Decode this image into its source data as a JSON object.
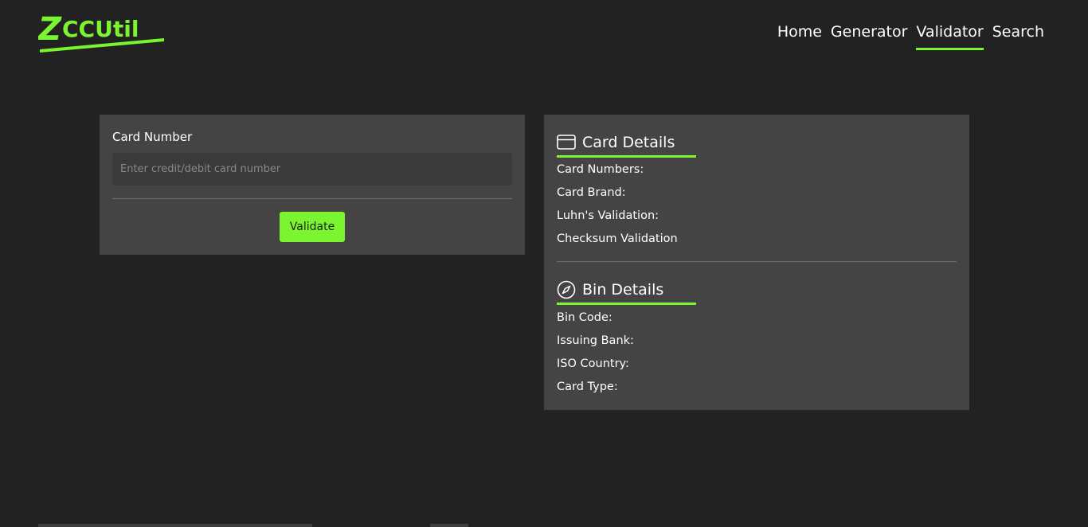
{
  "brand": {
    "logo_text": "ZCCUtil",
    "accent_color": "#7af530"
  },
  "nav": {
    "items": [
      {
        "label": "Home",
        "active": false
      },
      {
        "label": "Generator",
        "active": false
      },
      {
        "label": "Validator",
        "active": true
      },
      {
        "label": "Search",
        "active": false
      }
    ]
  },
  "form": {
    "card_number_label": "Card Number",
    "card_number_placeholder": "Enter credit/debit card number",
    "card_number_value": "",
    "validate_label": "Validate"
  },
  "card_details": {
    "heading": "Card Details",
    "icon": "credit-card-icon",
    "rows": [
      "Card Numbers:",
      "Card Brand:",
      "Luhn's Validation:",
      "Checksum Validation"
    ]
  },
  "bin_details": {
    "heading": "Bin Details",
    "icon": "compass-icon",
    "rows": [
      "Bin Code:",
      "Issuing Bank:",
      "ISO Country:",
      "Card Type:"
    ]
  }
}
